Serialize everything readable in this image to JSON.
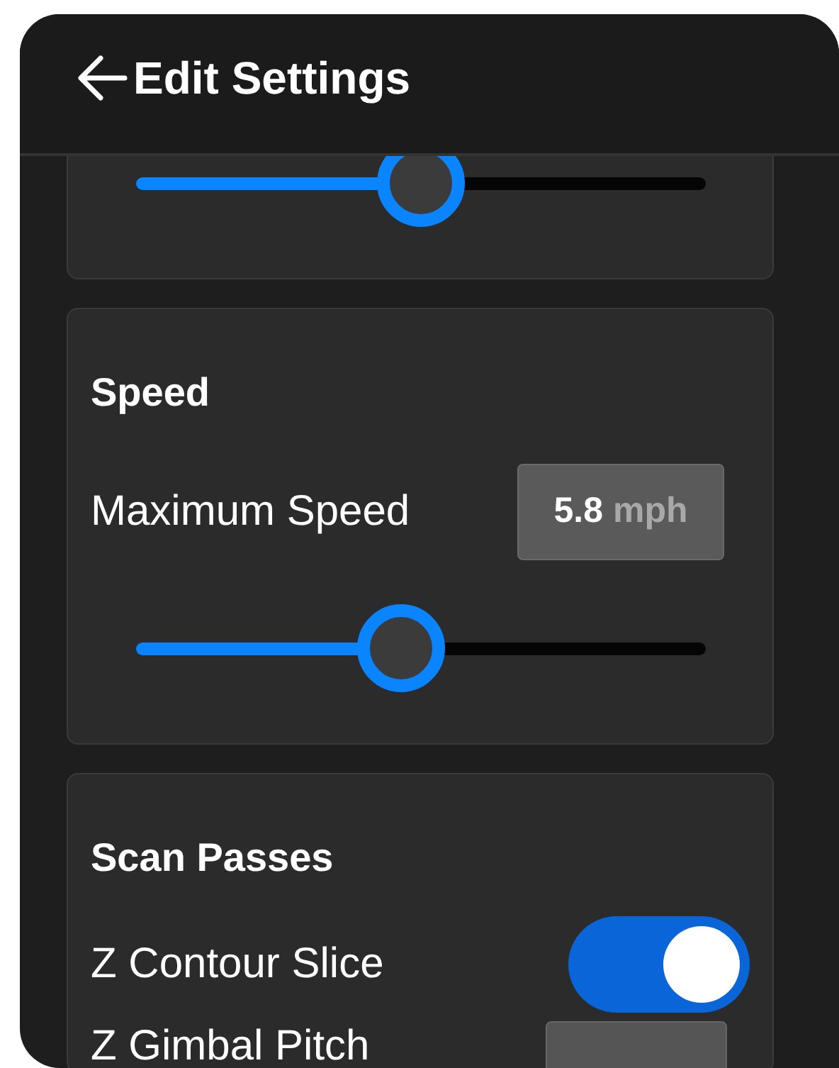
{
  "header": {
    "title": "Edit Settings"
  },
  "sections": [
    {
      "kind": "slider",
      "slider": {
        "level": 0.5
      }
    },
    {
      "kind": "speed",
      "title": "Speed",
      "label": "Maximum Speed",
      "value": "5.8",
      "unit": "mph",
      "slider": {
        "level": 0.465
      }
    },
    {
      "kind": "rows",
      "title": "Scan Passes",
      "rows": [
        {
          "kind": "toggle",
          "label": "Z Contour Slice",
          "on": true
        },
        {
          "kind": "field",
          "label": "Z Gimbal Pitch"
        }
      ]
    }
  ]
}
